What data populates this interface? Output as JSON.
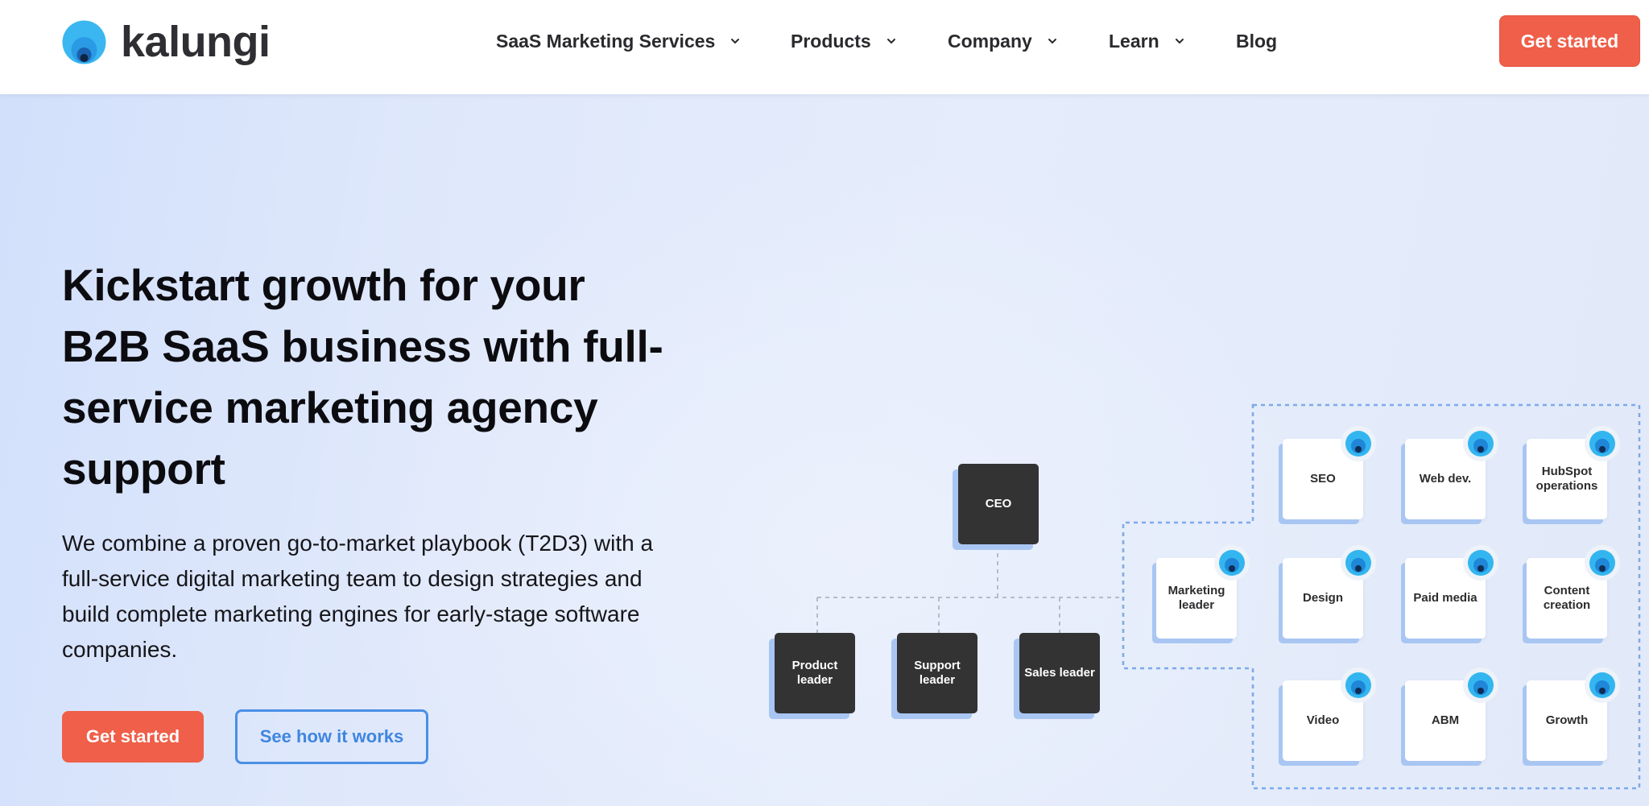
{
  "header": {
    "logo_text": "kalungi",
    "nav": [
      {
        "label": "SaaS Marketing Services",
        "has_dropdown": true
      },
      {
        "label": "Products",
        "has_dropdown": true
      },
      {
        "label": "Company",
        "has_dropdown": true
      },
      {
        "label": "Learn",
        "has_dropdown": true
      },
      {
        "label": "Blog",
        "has_dropdown": false
      }
    ],
    "cta_label": "Get started"
  },
  "hero": {
    "title": "Kickstart growth for your B2B SaaS business with full-service marketing agency support",
    "description": "We combine a proven go-to-market playbook (T2D3) with a full-service digital marketing team to design strategies and build complete marketing engines for early-stage software companies.",
    "primary_cta": "Get started",
    "secondary_cta": "See how it works"
  },
  "org_chart": {
    "ceo": "CEO",
    "leaders": [
      "Product leader",
      "Support leader",
      "Sales leader"
    ],
    "marketing_leader": "Marketing leader",
    "team": [
      [
        "SEO",
        "Web dev.",
        "HubSpot operations"
      ],
      [
        "Design",
        "Paid media",
        "Content creation"
      ],
      [
        "Video",
        "ABM",
        "Growth"
      ]
    ]
  },
  "colors": {
    "accent": "#ef5f49",
    "link_blue": "#3f86e0",
    "dark_node": "#333334",
    "logo_blue": "#33b6ef"
  }
}
